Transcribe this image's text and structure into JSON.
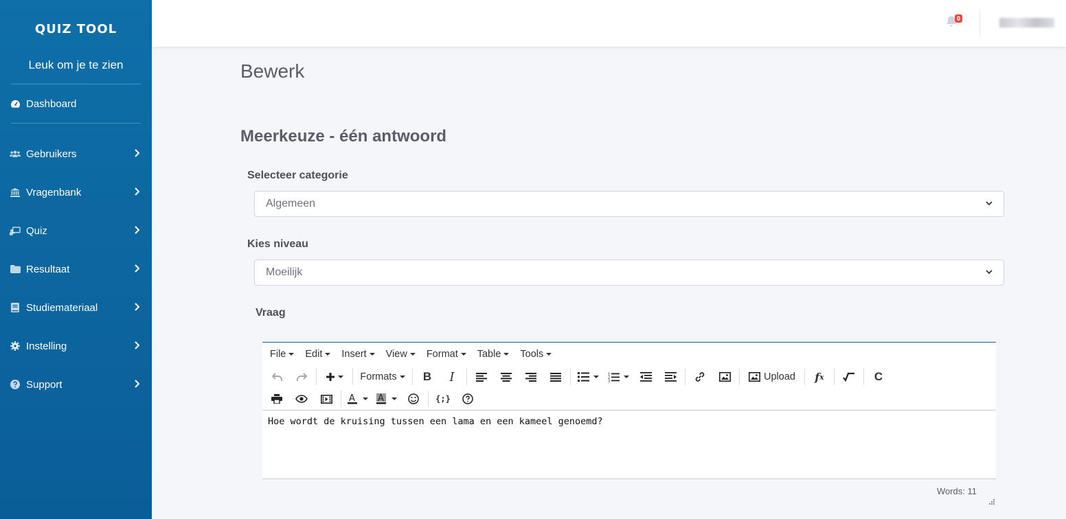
{
  "sidebar": {
    "brand": "QUIZ TOOL",
    "welcome": "Leuk om je te zien",
    "dashboard": "Dashboard",
    "items": [
      {
        "label": "Gebruikers",
        "icon": "users-icon"
      },
      {
        "label": "Vragenbank",
        "icon": "bank-icon"
      },
      {
        "label": "Quiz",
        "icon": "chalkboard-icon"
      },
      {
        "label": "Resultaat",
        "icon": "folder-icon"
      },
      {
        "label": "Studiemateriaal",
        "icon": "book-icon"
      },
      {
        "label": "Instelling",
        "icon": "gear-icon"
      },
      {
        "label": "Support",
        "icon": "question-circle-icon"
      }
    ]
  },
  "topbar": {
    "notification_count": "0"
  },
  "main": {
    "page_title": "Bewerk",
    "section_title": "Meerkeuze - één antwoord",
    "category_label": "Selecteer categorie",
    "category_value": "Algemeen",
    "level_label": "Kies niveau",
    "level_value": "Moeilijk",
    "question_label": "Vraag"
  },
  "editor": {
    "menus": [
      "File",
      "Edit",
      "Insert",
      "View",
      "Format",
      "Table",
      "Tools"
    ],
    "formats_label": "Formats",
    "upload_label": "Upload",
    "content": "Hoe wordt de kruising tussen een lama en een kameel genoemd?",
    "word_count": "Words: 11"
  },
  "colors": {
    "sidebar": "#0a67a3",
    "badge": "#e74a3b",
    "editor_border": "#1d5f86"
  }
}
